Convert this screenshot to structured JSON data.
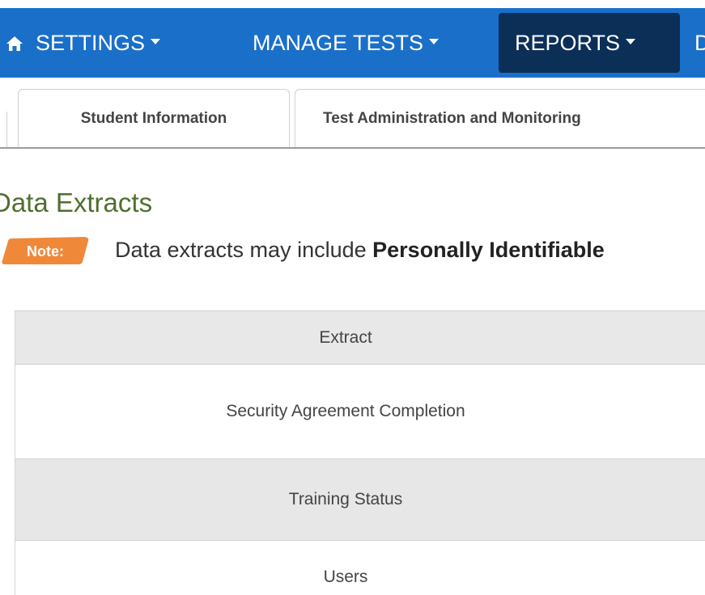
{
  "nav": {
    "home_icon": "home-icon",
    "items": [
      {
        "label": "SETTINGS"
      },
      {
        "label": "MANAGE TESTS"
      },
      {
        "label": "REPORTS"
      },
      {
        "label": "D"
      }
    ],
    "colors": {
      "bar": "#1a6fc9",
      "active": "#0c2f57"
    }
  },
  "tabs": [
    {
      "label": "Student Information"
    },
    {
      "label": "Test Administration and Monitoring"
    }
  ],
  "page": {
    "title": "Data Extracts",
    "title_color": "#4f6f2e"
  },
  "note": {
    "badge": "Note:",
    "badge_color": "#f0883a",
    "text_plain": "Data extracts may include ",
    "text_bold": "Personally Identifiable"
  },
  "table": {
    "header": "Extract",
    "rows": [
      "Security Agreement Completion",
      "Training Status",
      "Users"
    ]
  }
}
